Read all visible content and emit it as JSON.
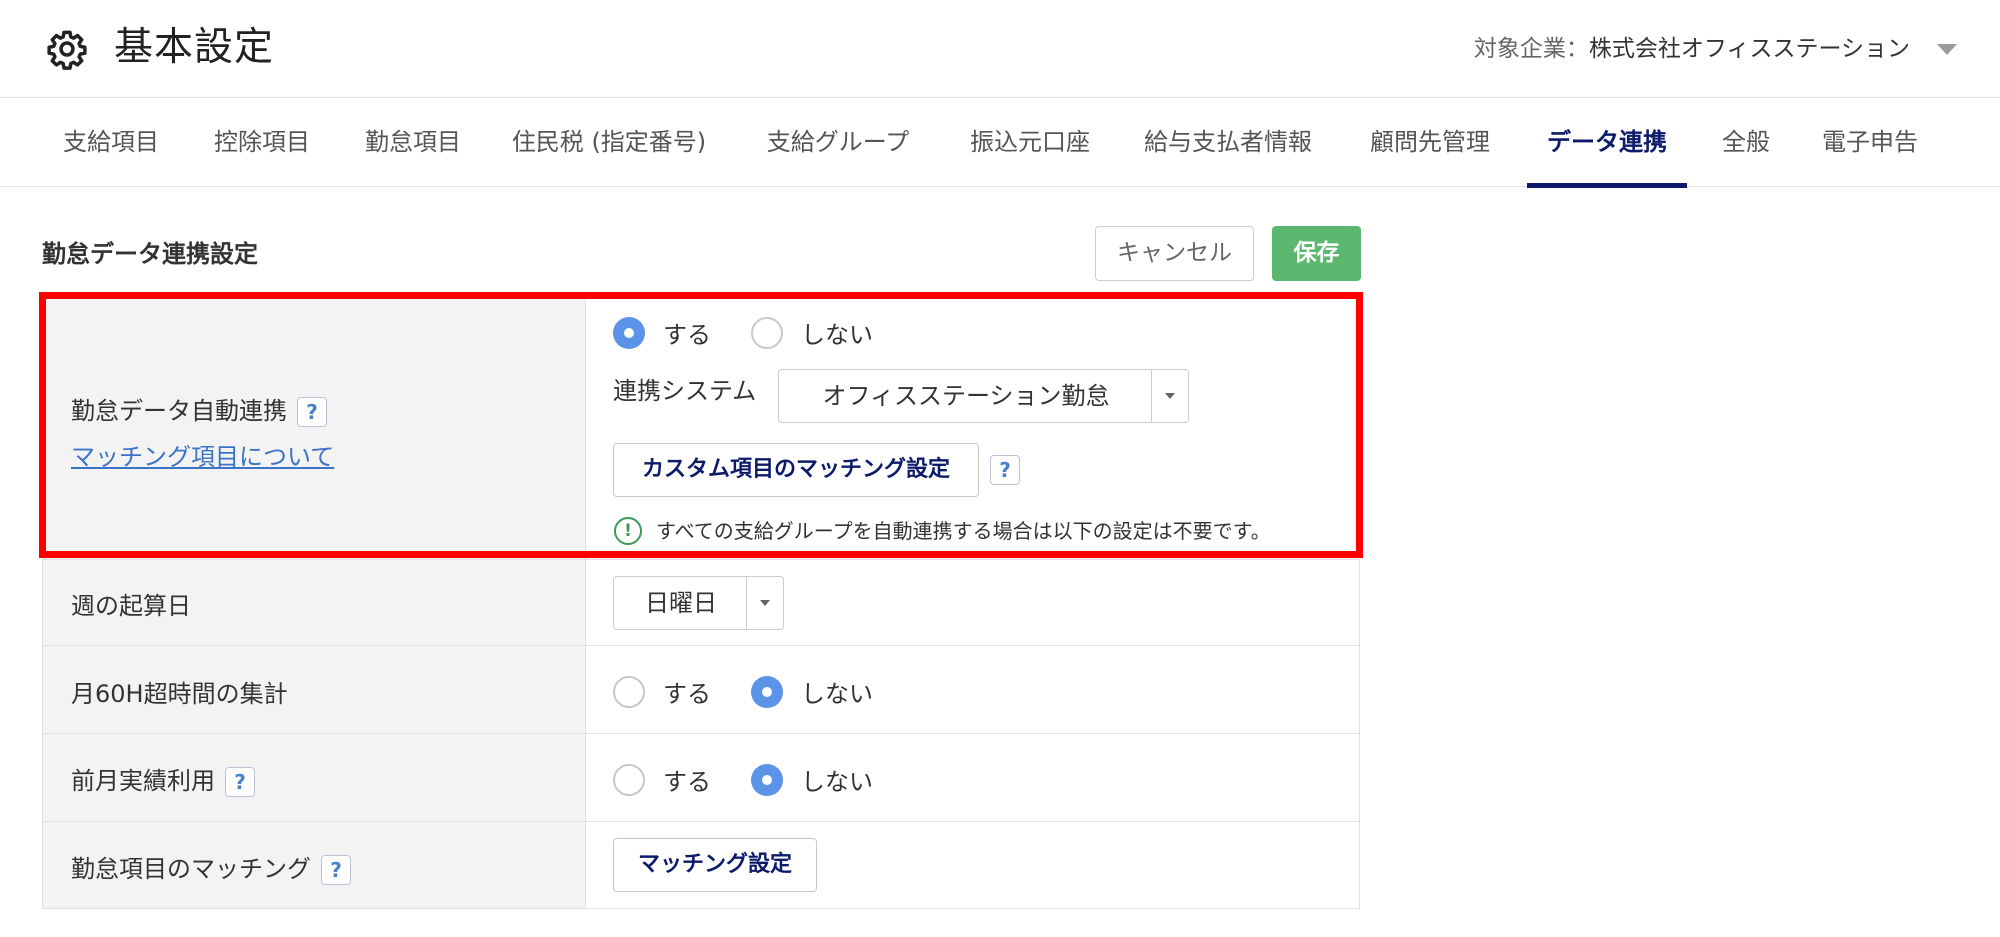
{
  "header": {
    "title": "基本設定",
    "company_label": "対象企業：",
    "company_name": "株式会社オフィスステーション"
  },
  "tabs": [
    {
      "label": "支給項目",
      "active": false
    },
    {
      "label": "控除項目",
      "active": false
    },
    {
      "label": "勤怠項目",
      "active": false
    },
    {
      "label": "住民税 (指定番号)",
      "active": false
    },
    {
      "label": "支給グループ",
      "active": false
    },
    {
      "label": "振込元口座",
      "active": false
    },
    {
      "label": "給与支払者情報",
      "active": false
    },
    {
      "label": "顧問先管理",
      "active": false
    },
    {
      "label": "データ連携",
      "active": true
    },
    {
      "label": "全般",
      "active": false
    },
    {
      "label": "電子申告",
      "active": false
    }
  ],
  "section": {
    "title": "勤怠データ連携設定",
    "cancel_label": "キャンセル",
    "save_label": "保存"
  },
  "rows": {
    "auto_link": {
      "label": "勤怠データ自動連携",
      "help": "?",
      "link": "マッチング項目について",
      "options": [
        "する",
        "しない"
      ],
      "selected": "する",
      "system_label": "連携システム",
      "system_value": "オフィスステーション勤怠",
      "custom_button": "カスタム項目のマッチング設定",
      "custom_help": "?",
      "notice": "すべての支給グループを自動連携する場合は以下の設定は不要です。"
    },
    "week_start": {
      "label": "週の起算日",
      "value": "日曜日"
    },
    "over60": {
      "label": "月60H超時間の集計",
      "options": [
        "する",
        "しない"
      ],
      "selected": "しない"
    },
    "prev_month": {
      "label": "前月実績利用",
      "help": "?",
      "options": [
        "する",
        "しない"
      ],
      "selected": "しない"
    },
    "matching": {
      "label": "勤怠項目のマッチング",
      "help": "?",
      "button": "マッチング設定"
    }
  },
  "colors": {
    "accent": "#0d1b6b",
    "save": "#5cb86e",
    "radio": "#5b93e8",
    "highlight": "#ff0000",
    "link": "#3b73c8"
  }
}
